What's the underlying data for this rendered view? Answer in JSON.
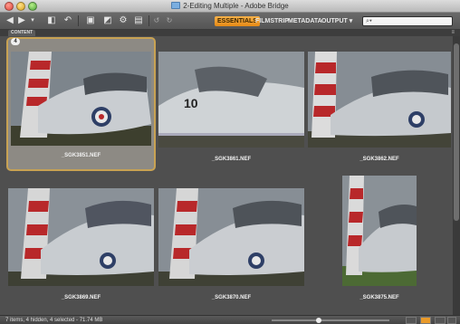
{
  "window": {
    "title": "2-Editing Multiple - Adobe Bridge"
  },
  "toolbar": {
    "workspaces": [
      "ESSENTIALS",
      "FILMSTRIP",
      "METADATA",
      "OUTPUT ▾"
    ],
    "active_workspace": "ESSENTIALS",
    "search_placeholder": "⌕▾",
    "icons": [
      "back-arrow-icon",
      "forward-arrow-icon",
      "history-dropdown-icon",
      "reveal-recent-icon",
      "boomerang-icon",
      "get-photos-icon",
      "refine-icon",
      "open-in-camera-raw-icon",
      "rotate-ccw-icon",
      "rotate-cw-icon"
    ]
  },
  "panel": {
    "tab_label": "CONTENT",
    "menu_glyph": "≡",
    "stack_count": "4"
  },
  "thumbnails": [
    {
      "filename": "_SGK3851.NEF",
      "selected": true
    },
    {
      "filename": "_SGK3861.NEF",
      "selected": false
    },
    {
      "filename": "_SGK3862.NEF",
      "selected": false
    },
    {
      "filename": "_SGK3869.NEF",
      "selected": false
    },
    {
      "filename": "_SGK3870.NEF",
      "selected": false
    },
    {
      "filename": "_SGK3875.NEF",
      "selected": false
    }
  ],
  "statusbar": {
    "text": "7 items, 4 hidden, 4 selected - 71.74 MB"
  },
  "colors": {
    "accent": "#e68a16",
    "selection_border": "#c8a253"
  }
}
